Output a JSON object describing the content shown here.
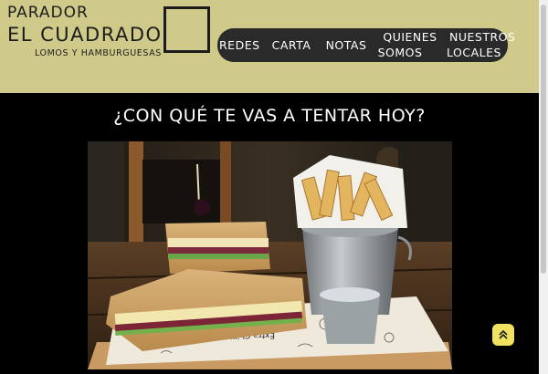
{
  "brand": {
    "line1": "PARADOR",
    "line2": "EL CUADRADO",
    "tagline": "LOMOS Y HAMBURGUESAS"
  },
  "nav": {
    "items": [
      {
        "line1": "REDES",
        "line2": ""
      },
      {
        "line1": "CARTA",
        "line2": ""
      },
      {
        "line1": "NOTAS",
        "line2": ""
      },
      {
        "line1": "QUIENES",
        "line2": "SOMOS"
      },
      {
        "line1": "NUESTROS",
        "line2": "LOCALES"
      }
    ]
  },
  "main": {
    "headline": "¿CON QUÉ TE VAS A TENTAR HOY?",
    "paper_text": "Extra Chilli"
  },
  "colors": {
    "header_bg": "#cfc98a",
    "nav_bg": "#2a2a2a",
    "page_bg": "#000000",
    "scroll_button_bg": "#f0e260"
  },
  "icons": {
    "logo": "square-outline-icon",
    "scroll_top": "double-chevron-up-icon"
  }
}
